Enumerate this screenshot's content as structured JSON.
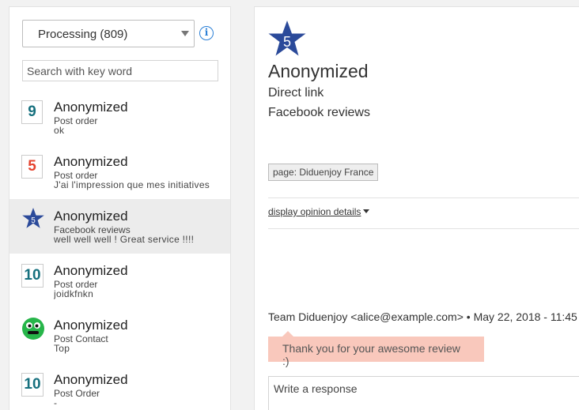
{
  "sidebar": {
    "status_filter": "Processing (809)",
    "search_placeholder": "Search with key word",
    "items": [
      {
        "badge": "9",
        "name": "Anonymized",
        "source": "Post order",
        "message": "ok"
      },
      {
        "badge": "5",
        "name": "Anonymized",
        "source": "Post order",
        "message": "J'ai l'impression que mes initiatives"
      },
      {
        "badge": "5",
        "name": "Anonymized",
        "source": "Facebook reviews",
        "message": "well well well ! Great service !!!!"
      },
      {
        "badge": "10",
        "name": "Anonymized",
        "source": "Post order",
        "message": "joidkfnkn"
      },
      {
        "badge": "",
        "name": "Anonymized",
        "source": "Post Contact",
        "message": "Top"
      },
      {
        "badge": "10",
        "name": "Anonymized",
        "source": "Post Order",
        "message": "-"
      }
    ]
  },
  "detail": {
    "rating": "5",
    "name": "Anonymized",
    "line1": "Direct link",
    "line2": "Facebook reviews",
    "page_tag": "page: Diduenjoy France",
    "details_link": "display opinion details",
    "reply_meta": "Team Diduenjoy <alice@example.com> • May 22, 2018 - 11:45",
    "reply_text": "Thank you for your awesome review :)",
    "response_placeholder": "Write a response"
  },
  "colors": {
    "star": "#2b4a9a",
    "teal_number": "#16707e",
    "red_number": "#e54430",
    "smiley": "#27b54a",
    "bubble": "#f9c8bc",
    "info": "#2a7fd6"
  }
}
